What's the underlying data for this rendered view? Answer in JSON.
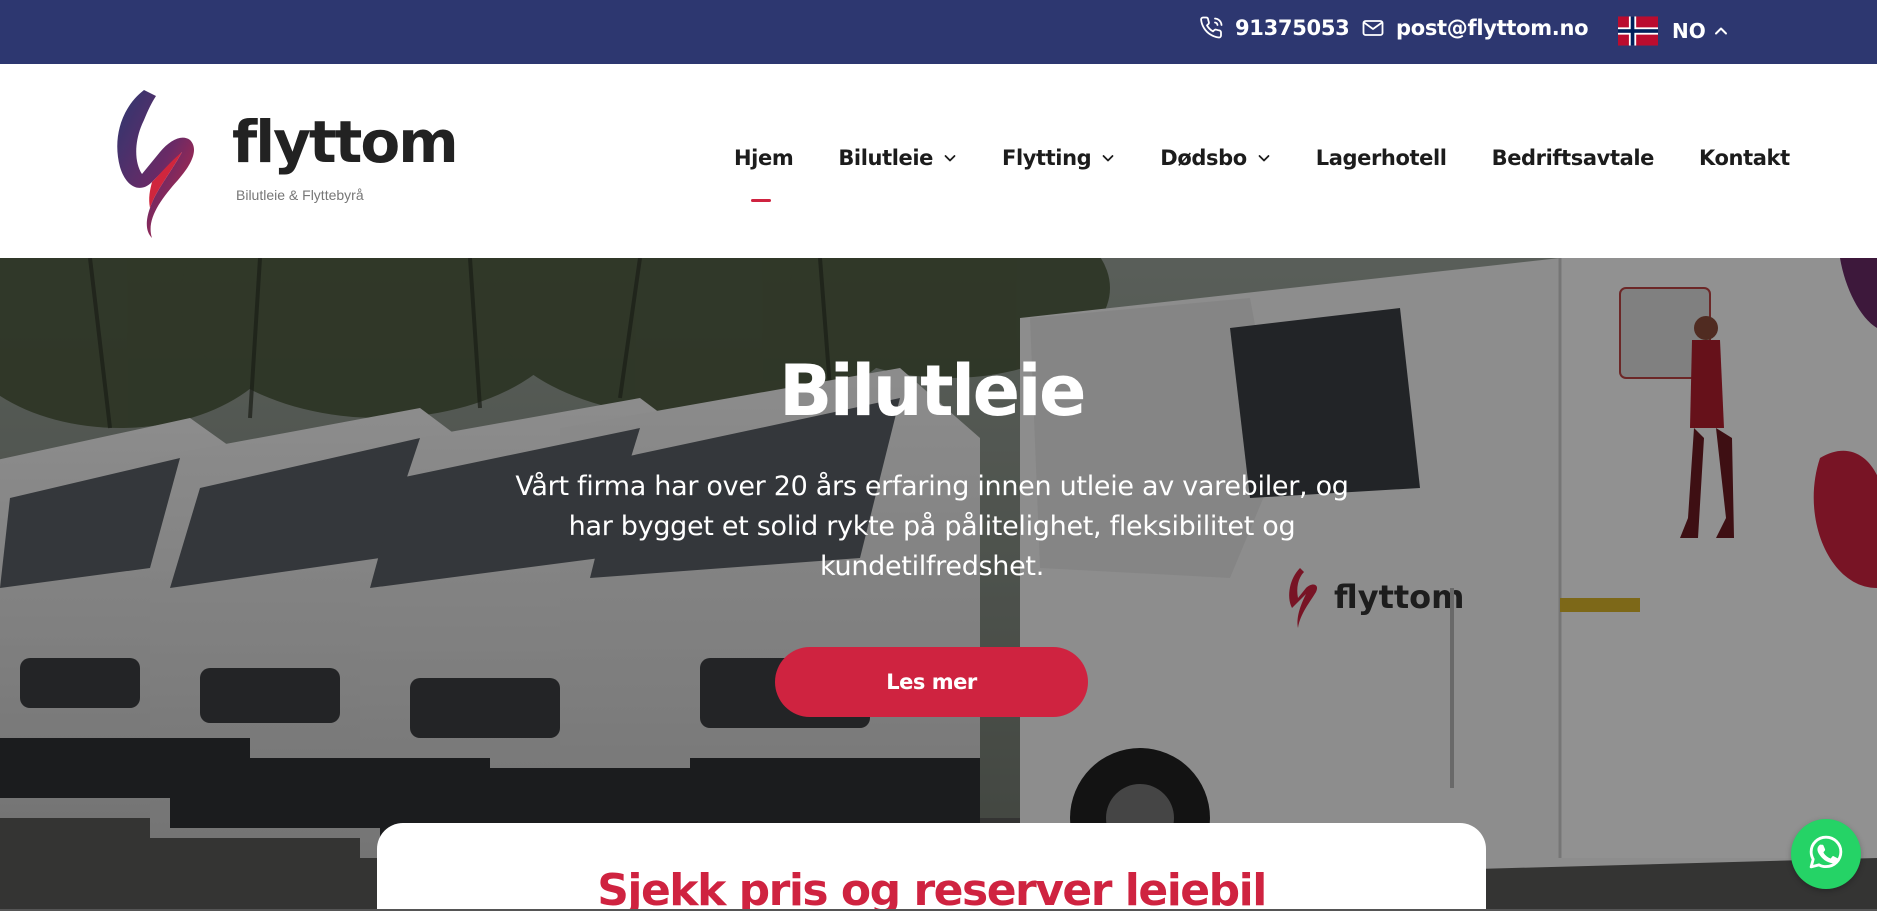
{
  "topbar": {
    "phone": "91375053",
    "email": "post@flyttom.no",
    "language": "NO",
    "icons": {
      "phone": "phone-icon",
      "email": "envelope-icon",
      "flag": "norway-flag-icon",
      "caret": "chevron-up-icon"
    }
  },
  "brand": {
    "name": "flyttom",
    "tagline": "Bilutleie & Flyttebyrå",
    "colors": {
      "navy": "#2d3770",
      "red": "#cf2340"
    }
  },
  "nav": {
    "items": [
      {
        "label": "Hjem",
        "active": true,
        "dropdown": false
      },
      {
        "label": "Bilutleie",
        "active": false,
        "dropdown": true
      },
      {
        "label": "Flytting",
        "active": false,
        "dropdown": true
      },
      {
        "label": "Dødsbo",
        "active": false,
        "dropdown": true
      },
      {
        "label": "Lagerhotell",
        "active": false,
        "dropdown": false
      },
      {
        "label": "Bedriftsavtale",
        "active": false,
        "dropdown": false
      },
      {
        "label": "Kontakt",
        "active": false,
        "dropdown": false
      }
    ]
  },
  "hero": {
    "title": "Bilutleie",
    "text": "Vårt firma har over 20 års erfaring innen utleie av varebiler, og har bygget et solid rykte på pålitelighet, fleksibilitet og kundetilfredshet.",
    "button_label": "Les mer",
    "van_logo_text": "flyttom"
  },
  "booking": {
    "title": "Sjekk pris og reserver leiebil"
  },
  "whatsapp": {
    "icon": "whatsapp-icon",
    "color": "#25d366"
  }
}
